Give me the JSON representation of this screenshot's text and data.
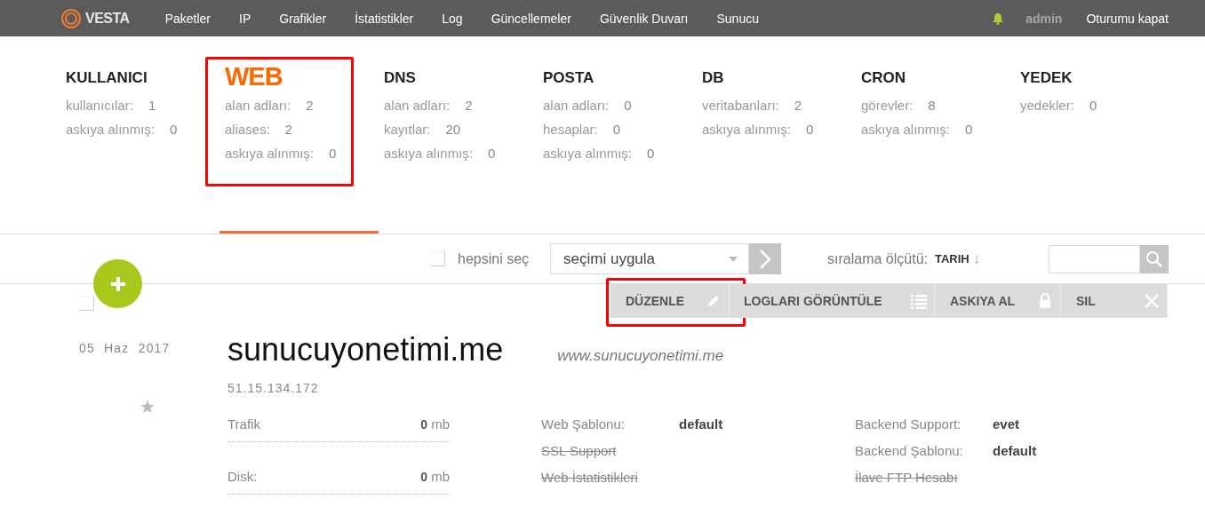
{
  "topbar": {
    "logo": "VESTA",
    "nav": [
      "Paketler",
      "IP",
      "Grafikler",
      "İstatistikler",
      "Log",
      "Güncellemeler",
      "Güvenlik Duvarı",
      "Sunucu"
    ],
    "user": "admin",
    "logout": "Oturumu kapat"
  },
  "sections": [
    {
      "title": "KULLANICI",
      "selected": false,
      "highlighted": false,
      "stats": [
        {
          "label": "kullanıcılar:",
          "value": "1"
        },
        {
          "label": "askıya alınmış:",
          "value": "0"
        }
      ]
    },
    {
      "title": "WEB",
      "selected": true,
      "highlighted": true,
      "stats": [
        {
          "label": "alan adları:",
          "value": "2"
        },
        {
          "label": "aliases:",
          "value": "2"
        },
        {
          "label": "askıya alınmış:",
          "value": "0"
        }
      ]
    },
    {
      "title": "DNS",
      "selected": false,
      "highlighted": false,
      "stats": [
        {
          "label": "alan adları:",
          "value": "2"
        },
        {
          "label": "kayıtlar:",
          "value": "20"
        },
        {
          "label": "askıya alınmış:",
          "value": "0"
        }
      ]
    },
    {
      "title": "POSTA",
      "selected": false,
      "highlighted": false,
      "stats": [
        {
          "label": "alan adları:",
          "value": "0"
        },
        {
          "label": "hesaplar:",
          "value": "0"
        },
        {
          "label": "askıya alınmış:",
          "value": "0"
        }
      ]
    },
    {
      "title": "DB",
      "selected": false,
      "highlighted": false,
      "stats": [
        {
          "label": "veritabanları:",
          "value": "2"
        },
        {
          "label": "askıya alınmış:",
          "value": "0"
        }
      ]
    },
    {
      "title": "CRON",
      "selected": false,
      "highlighted": false,
      "stats": [
        {
          "label": "görevler:",
          "value": "8"
        },
        {
          "label": "askıya alınmış:",
          "value": "0"
        }
      ]
    },
    {
      "title": "YEDEK",
      "selected": false,
      "highlighted": false,
      "stats": [
        {
          "label": "yedekler:",
          "value": "0"
        }
      ]
    }
  ],
  "toolbar": {
    "select_all": {
      "label": "hepsini seç",
      "checked": false
    },
    "bulk_action": {
      "value": "seçimi uygula"
    },
    "sort": {
      "label": "sıralama ölçütü:",
      "value": "TARIH",
      "arrow": "↓"
    }
  },
  "actions": [
    {
      "kind": "edit",
      "label": "DÜZENLE",
      "highlighted": true
    },
    {
      "kind": "logs",
      "label": "LOGLARI GÖRÜNTÜLE",
      "highlighted": false
    },
    {
      "kind": "suspend",
      "label": "ASKIYA AL",
      "highlighted": false
    },
    {
      "kind": "delete",
      "label": "SIL",
      "highlighted": false
    }
  ],
  "record": {
    "checked": false,
    "starred": false,
    "date": "05 Haz 2017",
    "domain": "sunucuyonetimi.me",
    "alias": "www.sunucuyonetimi.me",
    "ip": "51.15.134.172",
    "usage": [
      {
        "label": "Trafik",
        "value": "0",
        "unit": "mb"
      },
      {
        "label": "Disk:",
        "value": "0",
        "unit": "mb"
      }
    ],
    "settings": [
      [
        {
          "label": "Web Şablonu:",
          "value": "default",
          "enabled": true
        },
        {
          "label": "SSL Support",
          "enabled": false
        },
        {
          "label": "Web İstatistikleri",
          "enabled": false
        }
      ],
      [
        {
          "label": "Backend Support:",
          "value": "evet",
          "enabled": true
        },
        {
          "label": "Backend Şablonu:",
          "value": "default",
          "enabled": true
        },
        {
          "label": "İlave FTP Hesabı",
          "enabled": false
        }
      ]
    ]
  }
}
